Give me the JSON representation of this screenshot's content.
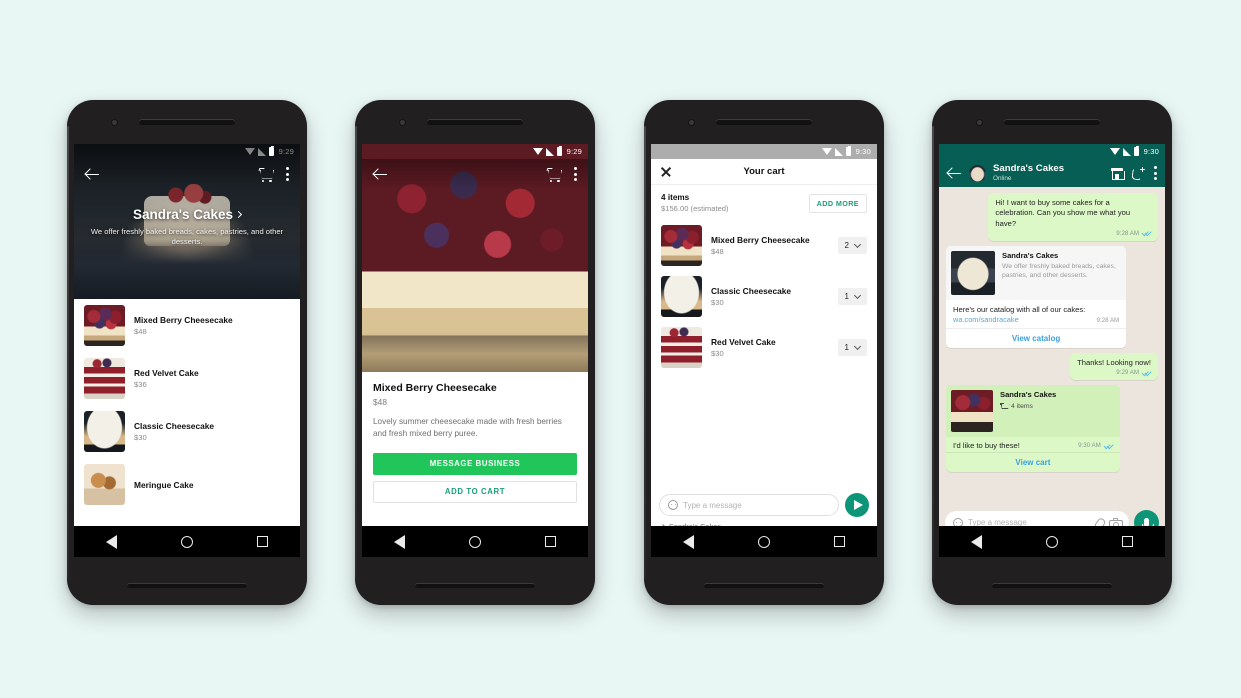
{
  "business": {
    "name": "Sandra's Cakes",
    "description": "We offer freshly baked breads, cakes, pastries, and other desserts.",
    "description_short": "We offer freshly baked breads, cakes, pastries, and other desserts."
  },
  "phone1": {
    "status": {
      "time": "9:29"
    },
    "products": [
      {
        "name": "Mixed Berry Cheesecake",
        "price": "$48"
      },
      {
        "name": "Red Velvet Cake",
        "price": "$36"
      },
      {
        "name": "Classic Cheesecake",
        "price": "$30"
      },
      {
        "name": "Meringue Cake",
        "price": ""
      }
    ]
  },
  "phone2": {
    "status": {
      "time": "9:29"
    },
    "product": {
      "name": "Mixed Berry Cheesecake",
      "price": "$48",
      "description": "Lovely summer cheesecake made with fresh berries and fresh mixed berry puree."
    },
    "buttons": {
      "message": "MESSAGE BUSINESS",
      "add_to_cart": "ADD TO CART"
    }
  },
  "phone3": {
    "status": {
      "time": "9:30"
    },
    "header": {
      "title": "Your cart"
    },
    "summary": {
      "count": "4 items",
      "total": "$156.00 (estimated)",
      "add_more": "ADD MORE"
    },
    "items": [
      {
        "name": "Mixed Berry Cheesecake",
        "price": "$48",
        "qty": "2"
      },
      {
        "name": "Classic Cheesecake",
        "price": "$30",
        "qty": "1"
      },
      {
        "name": "Red Velvet Cake",
        "price": "$30",
        "qty": "1"
      }
    ],
    "input": {
      "placeholder": "Type a message"
    },
    "footer": {
      "business": "Sandra's Cakes"
    }
  },
  "phone4": {
    "status": {
      "time": "9:30"
    },
    "header": {
      "name": "Sandra's Cakes",
      "presence": "Online"
    },
    "messages": {
      "m1": {
        "text": "Hi! I want to buy some cakes for a celebration. Can you show me what you have?",
        "time": "9:28 AM"
      },
      "catalog": {
        "title": "Sandra's Cakes",
        "desc": "We offer freshly baked breads, cakes, pastries, and other desserts.",
        "line": "Here's our catalog with all of our cakes:",
        "link": "wa.com/sandracake",
        "time": "9:28 AM",
        "action": "View catalog"
      },
      "m2": {
        "text": "Thanks! Looking now!",
        "time": "9:29 AM"
      },
      "cart": {
        "title": "Sandra's Cakes",
        "items": "4 items",
        "line": "I'd like to buy these!",
        "time": "9:30 AM",
        "action": "View cart"
      }
    },
    "input": {
      "placeholder": "Type a message"
    }
  },
  "colors": {
    "background": "#e8f6f4",
    "whatsapp_header": "#075e54",
    "accent_green": "#21c65a",
    "teal": "#0c9577",
    "link_blue": "#3aa0e0",
    "bubble_out": "#dcf8c6"
  }
}
